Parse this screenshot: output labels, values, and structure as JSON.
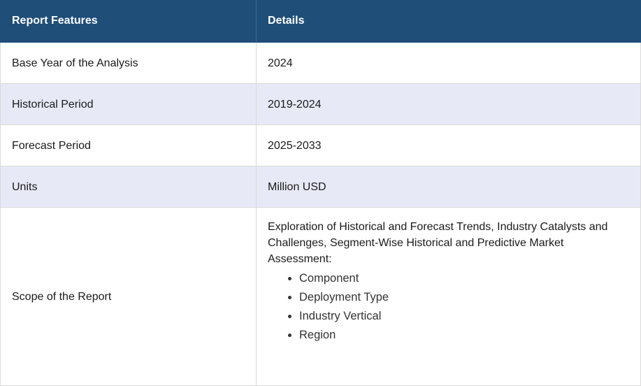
{
  "table": {
    "headers": [
      "Report Features",
      "Details"
    ],
    "rows": [
      {
        "feature": "Base Year of the Analysis",
        "detail": "2024"
      },
      {
        "feature": "Historical Period",
        "detail": "2019-2024"
      },
      {
        "feature": "Forecast Period",
        "detail": "2025-2033"
      },
      {
        "feature": "Units",
        "detail": "Million USD"
      }
    ],
    "scope": {
      "feature": "Scope of the Report",
      "text": "Exploration of Historical and Forecast Trends, Industry Catalysts and Challenges, Segment-Wise Historical and Predictive Market Assessment:",
      "items": [
        "Component",
        "Deployment Type",
        "Industry Vertical",
        "Region"
      ]
    }
  }
}
